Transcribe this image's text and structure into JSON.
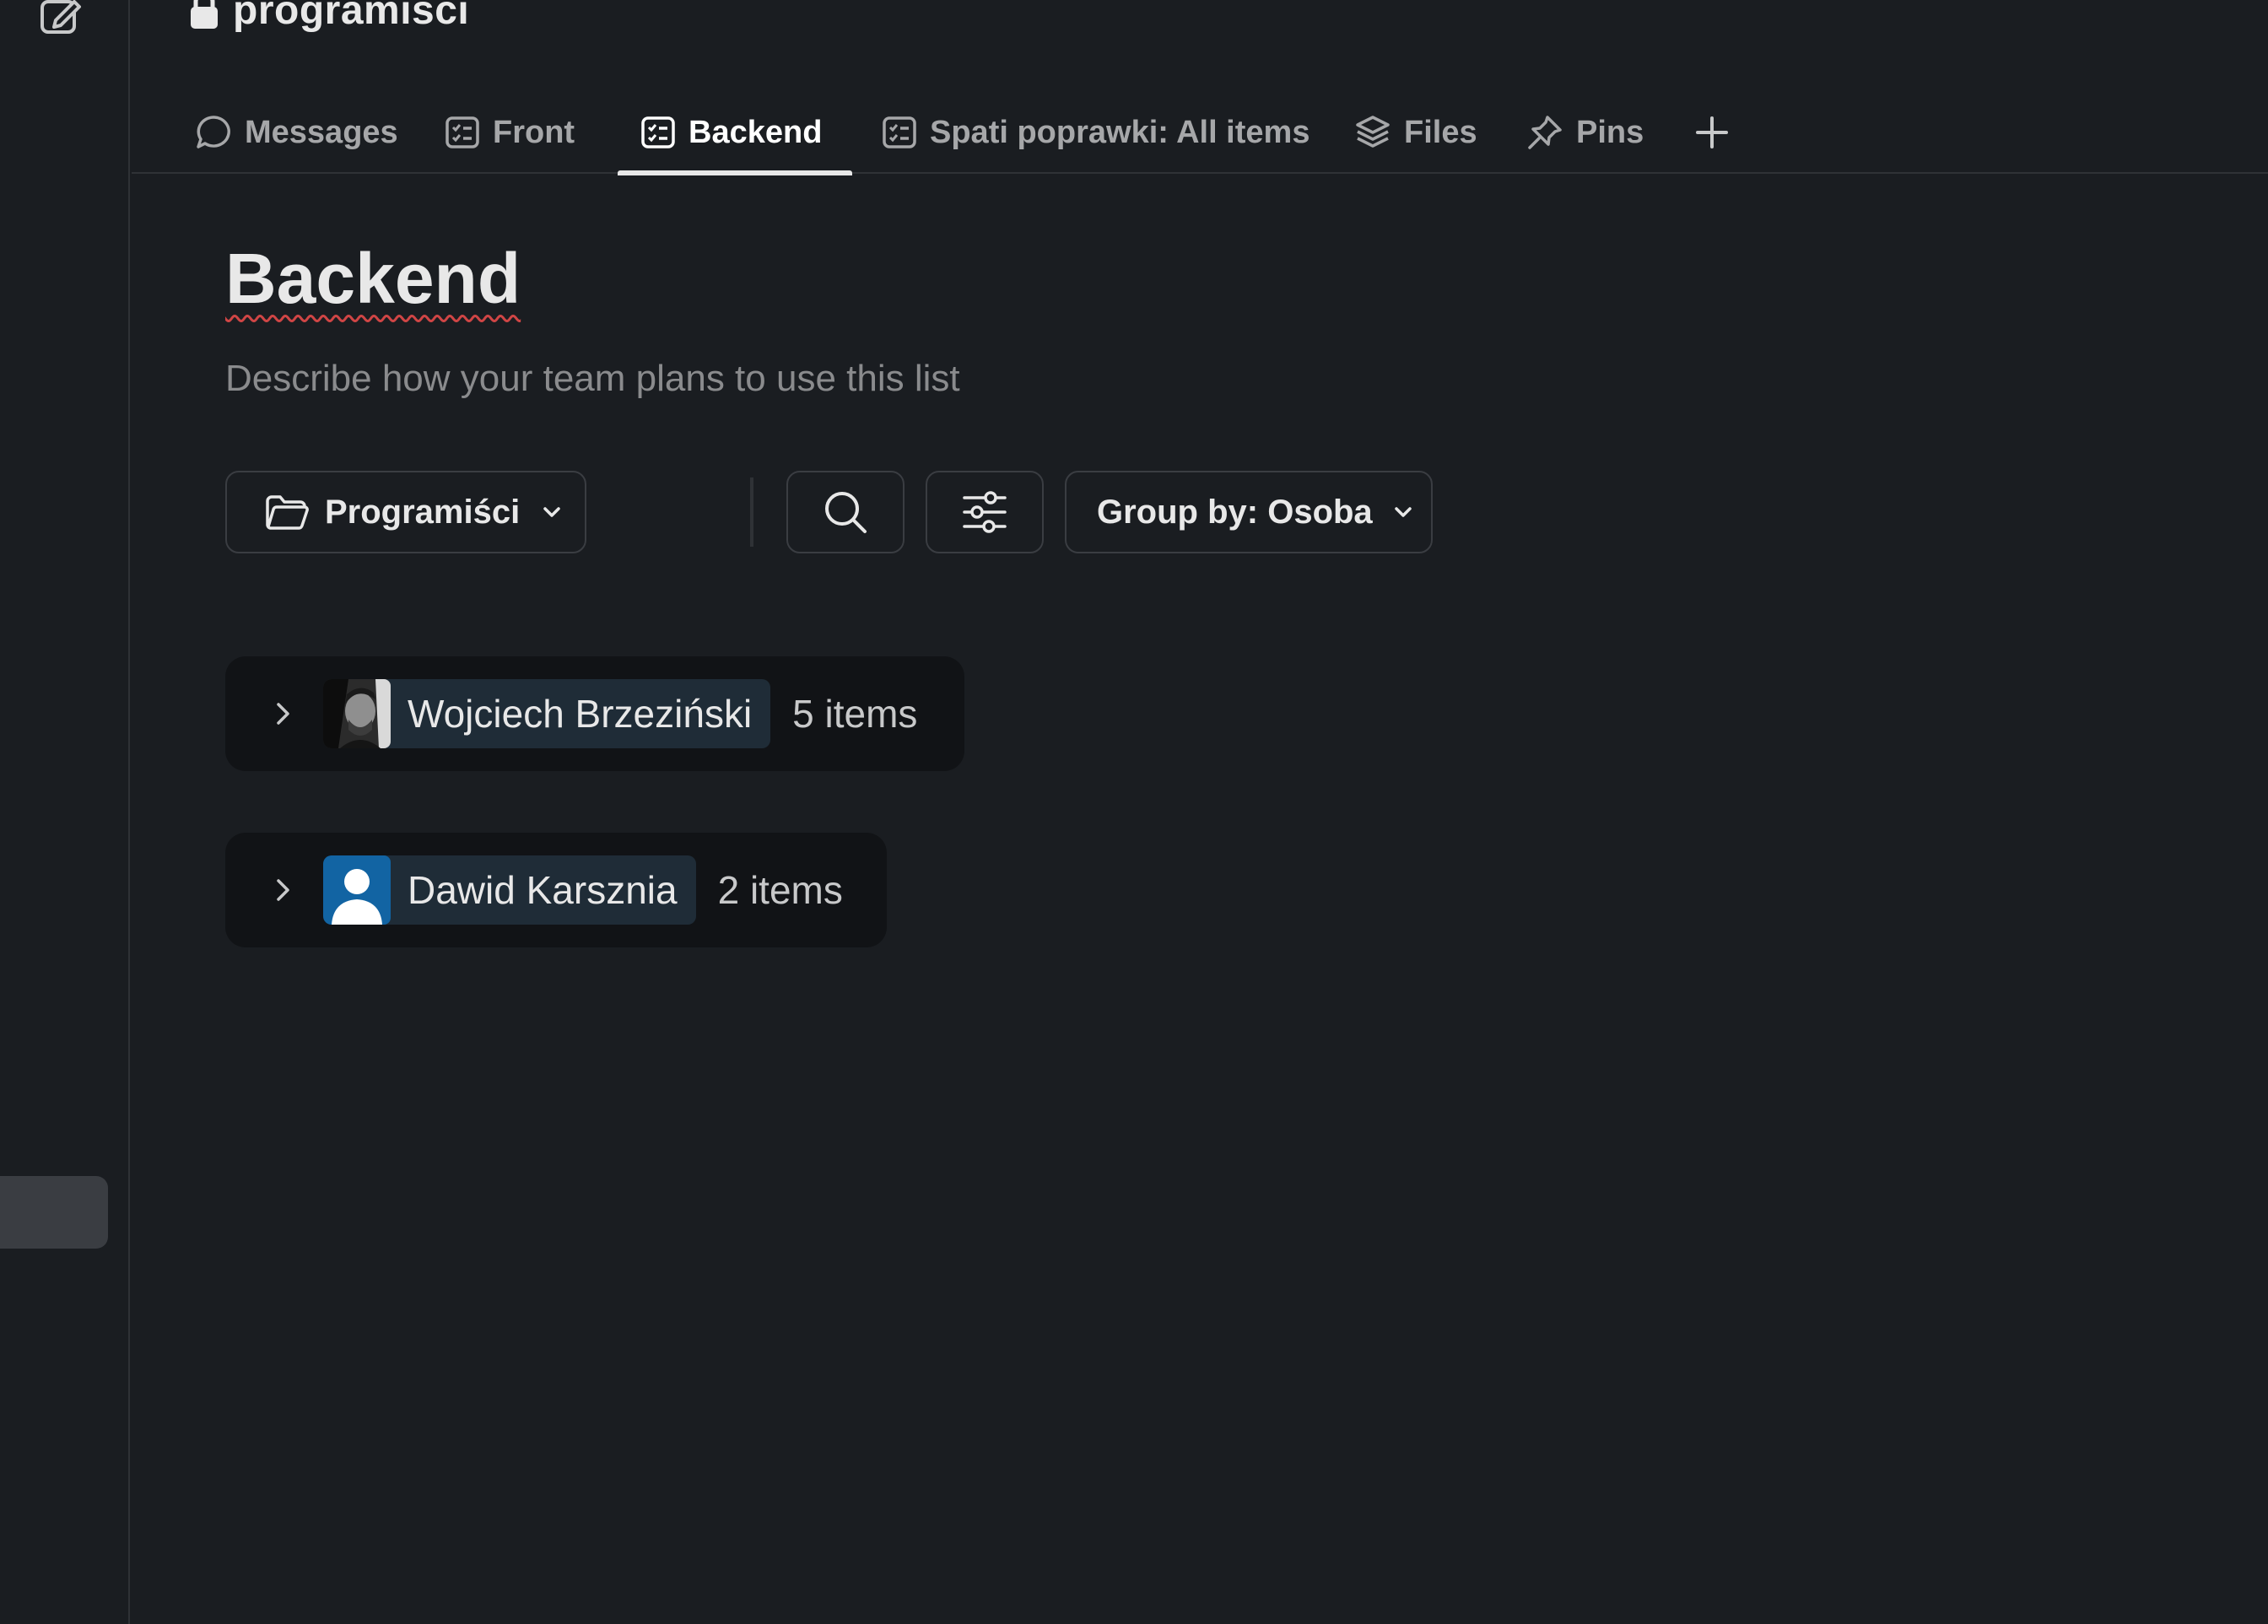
{
  "channel": {
    "name": "programisci"
  },
  "tabs": [
    {
      "label": "Messages",
      "icon": "message-icon",
      "active": false
    },
    {
      "label": "Front",
      "icon": "list-icon",
      "active": false
    },
    {
      "label": "Backend",
      "icon": "list-icon",
      "active": true
    },
    {
      "label": "Spati poprawki: All items",
      "icon": "list-icon",
      "active": false
    },
    {
      "label": "Files",
      "icon": "layers-icon",
      "active": false
    },
    {
      "label": "Pins",
      "icon": "pin-icon",
      "active": false
    }
  ],
  "list": {
    "title": "Backend",
    "description": "Describe how your team plans to use this list"
  },
  "toolbar": {
    "folder_label": "Programiści",
    "group_by_label": "Group by: Osoba"
  },
  "groups": [
    {
      "name": "Wojciech Brzeziński",
      "count": "5 items",
      "avatar": "photo"
    },
    {
      "name": "Dawid Karsznia",
      "count": "2 items",
      "avatar": "default-user"
    }
  ],
  "colors": {
    "background": "#1a1d21",
    "group_background": "#111316",
    "chip_background": "#1f2c37",
    "default_avatar": "#1264a3"
  }
}
